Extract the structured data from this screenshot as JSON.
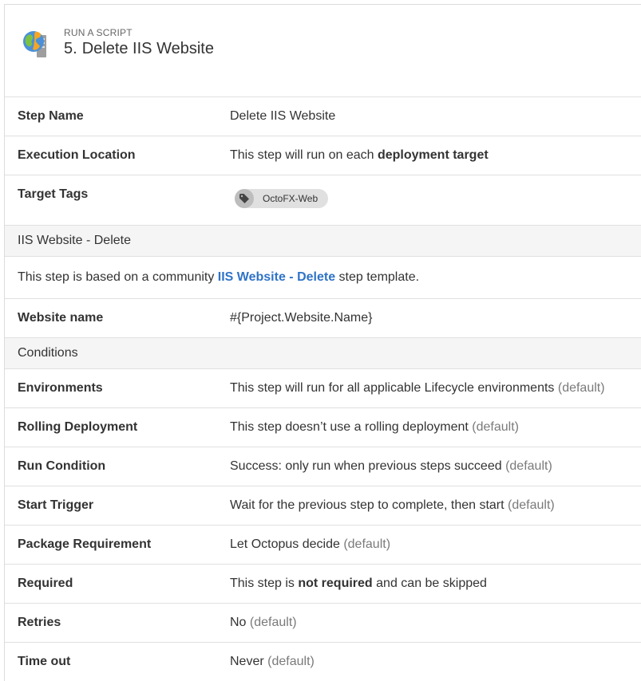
{
  "header": {
    "supertitle": "RUN A SCRIPT",
    "step_number": "5.",
    "step_title": "Delete IIS Website",
    "icon": "globe-server-icon"
  },
  "rows_top": [
    {
      "label": "Step Name",
      "value": "Delete IIS Website"
    },
    {
      "label": "Execution Location",
      "value_prefix": "This step will run on each ",
      "value_bold": "deployment target"
    },
    {
      "label": "Target Tags",
      "chip": {
        "icon": "tag-icon",
        "text": "OctoFX-Web"
      }
    }
  ],
  "template_section": {
    "title": "IIS Website - Delete",
    "note_prefix": "This step is based on a community ",
    "note_link": "IIS Website - Delete",
    "note_suffix": " step template.",
    "website_name_label": "Website name",
    "website_name_value": "#{Project.Website.Name}"
  },
  "conditions": {
    "title": "Conditions",
    "default_tag": "(default)",
    "rows": [
      {
        "label": "Environments",
        "value": "This step will run for all applicable Lifecycle environments",
        "default": "(default)"
      },
      {
        "label": "Rolling Deployment",
        "value": "This step doesn’t use a rolling deployment",
        "default": "(default)"
      },
      {
        "label": "Run Condition",
        "value": "Success: only run when previous steps succeed",
        "default": "(default)"
      },
      {
        "label": "Start Trigger",
        "value": "Wait for the previous step to complete, then start",
        "default": "(default)"
      },
      {
        "label": "Package Requirement",
        "value": "Let Octopus decide",
        "default": "(default)"
      },
      {
        "label": "Required",
        "value_prefix": "This step is ",
        "value_bold": "not required",
        "value_suffix": " and can be skipped"
      },
      {
        "label": "Retries",
        "value": "No",
        "default": "(default)"
      },
      {
        "label": "Time out",
        "value": "Never",
        "default": "(default)"
      }
    ]
  },
  "colors": {
    "link": "#2f73c7",
    "section_bg": "#f5f5f5",
    "chip_bg": "#e0e0e0",
    "default_text": "#7a7a7a"
  }
}
